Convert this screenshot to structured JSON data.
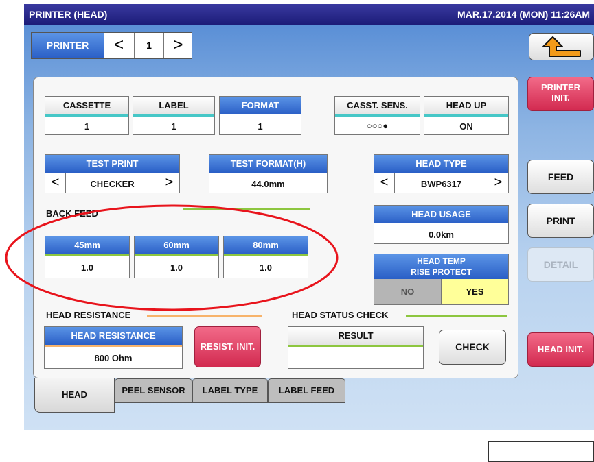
{
  "header": {
    "title": "PRINTER (HEAD)",
    "datetime": "MAR.17.2014 (MON) 11:26AM"
  },
  "printer_selector": {
    "label": "PRINTER",
    "prev": "<",
    "value": "1",
    "next": ">"
  },
  "top_tiles": [
    {
      "label": "CASSETTE",
      "value": "1"
    },
    {
      "label": "LABEL",
      "value": "1"
    },
    {
      "label": "FORMAT",
      "value": "1"
    },
    {
      "label": "CASST. SENS.",
      "value": "○○○●"
    },
    {
      "label": "HEAD UP",
      "value": "ON"
    }
  ],
  "test_print": {
    "label": "TEST PRINT",
    "value": "CHECKER",
    "prev": "<",
    "next": ">"
  },
  "test_format": {
    "label": "TEST FORMAT(H)",
    "value": "44.0mm"
  },
  "head_type": {
    "label": "HEAD TYPE",
    "value": "BWP6317",
    "prev": "<",
    "next": ">"
  },
  "head_usage": {
    "label": "HEAD USAGE",
    "value": "0.0km"
  },
  "back_feed": {
    "title": "BACK FEED",
    "items": [
      {
        "label": "45mm",
        "value": "1.0"
      },
      {
        "label": "60mm",
        "value": "1.0"
      },
      {
        "label": "80mm",
        "value": "1.0"
      }
    ]
  },
  "head_temp": {
    "label_line1": "HEAD TEMP",
    "label_line2": "RISE PROTECT",
    "no": "NO",
    "yes": "YES",
    "selected": "YES"
  },
  "head_resistance": {
    "section_title": "HEAD RESISTANCE",
    "label": "HEAD RESISTANCE",
    "value": "800 Ohm",
    "init_button": "RESIST. INIT."
  },
  "head_status": {
    "section_title": "HEAD STATUS CHECK",
    "result_label": "RESULT",
    "result_value": "",
    "check_button": "CHECK"
  },
  "tabs": [
    "HEAD",
    "PEEL SENSOR",
    "LABEL TYPE",
    "LABEL FEED"
  ],
  "active_tab": "HEAD",
  "side_buttons": {
    "printer_init_1": "PRINTER",
    "printer_init_2": "INIT.",
    "feed": "FEED",
    "print": "PRINT",
    "detail": "DETAIL",
    "head_init": "HEAD INIT."
  },
  "colors": {
    "accent_blue": "#2a5fc6",
    "teal_line": "#46c7c7",
    "green_line": "#8dc63f",
    "orange_line": "#f7b36b",
    "pink_button": "#d22a50",
    "yes_selected": "#ffff99",
    "annotation_red": "#e8141c"
  }
}
